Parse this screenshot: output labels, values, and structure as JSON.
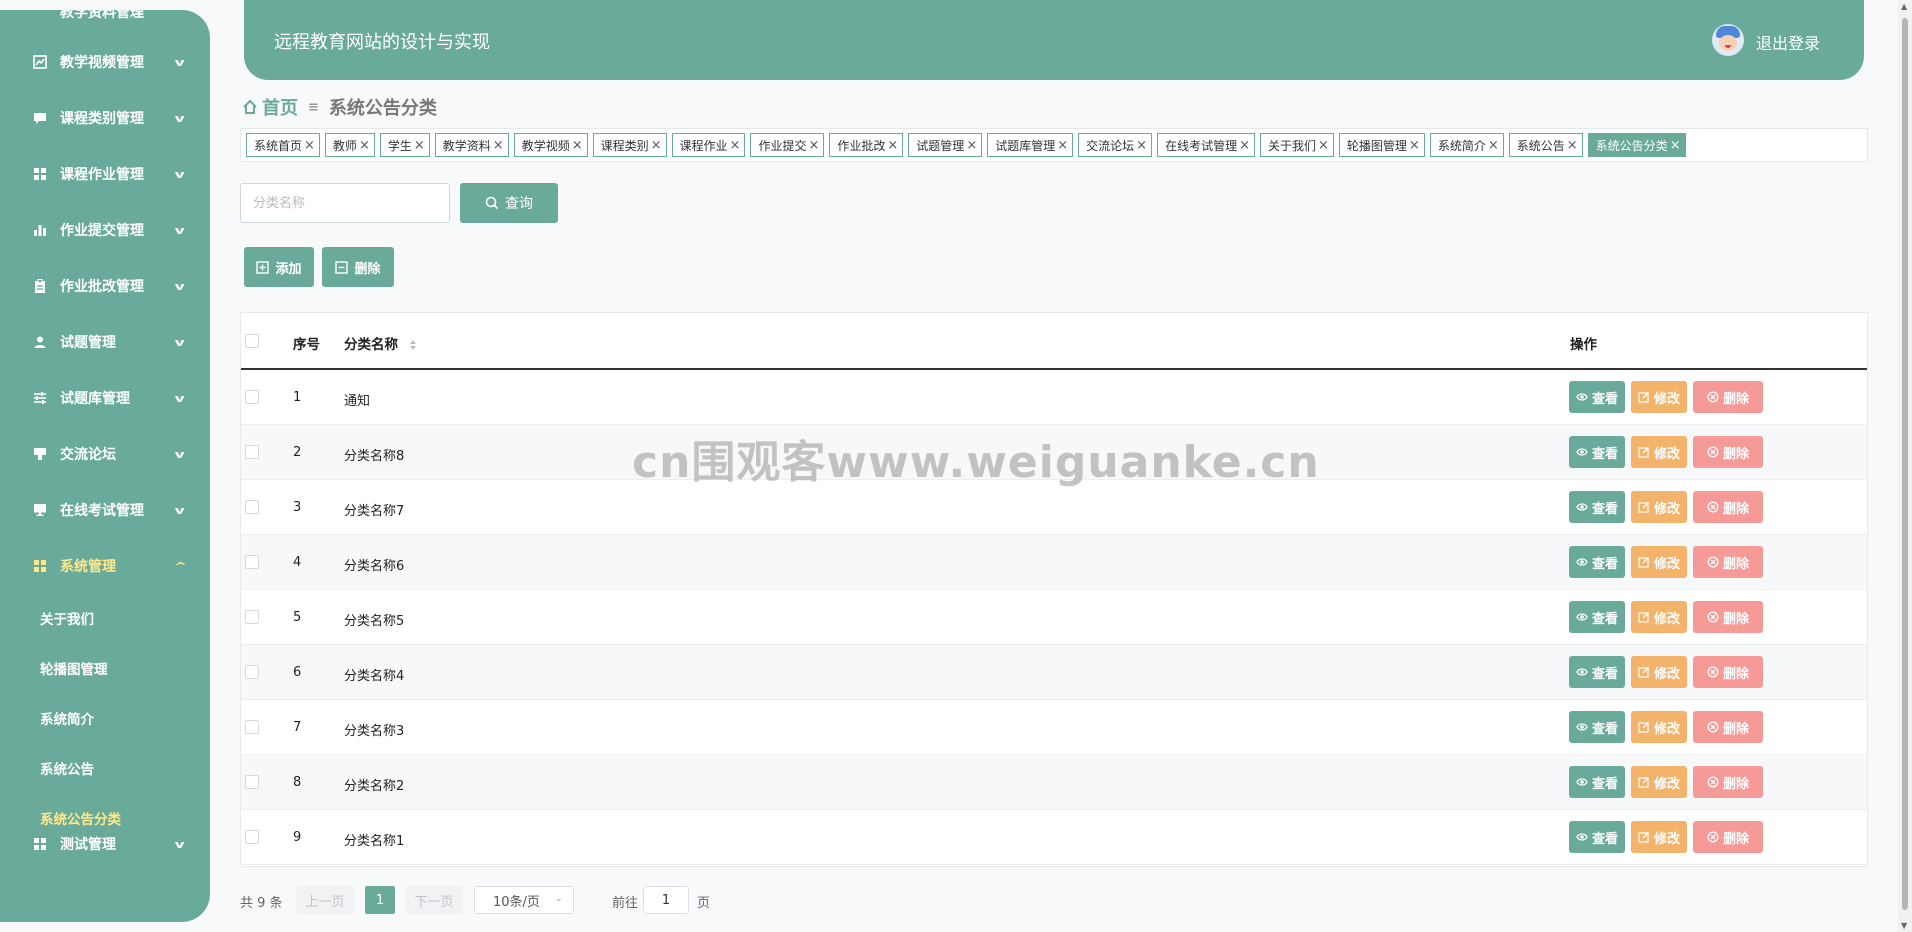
{
  "header": {
    "title": "远程教育网站的设计与实现",
    "logout": "退出登录"
  },
  "sidebar": {
    "top_partial": "教学资料管理",
    "items": [
      {
        "label": "教学视频管理",
        "icon": "chart-icon",
        "expanded": false
      },
      {
        "label": "课程类别管理",
        "icon": "chat-icon",
        "expanded": false
      },
      {
        "label": "课程作业管理",
        "icon": "grid-icon",
        "expanded": false
      },
      {
        "label": "作业提交管理",
        "icon": "bar-chart-icon",
        "expanded": false
      },
      {
        "label": "作业批改管理",
        "icon": "clipboard-icon",
        "expanded": false
      },
      {
        "label": "试题管理",
        "icon": "user-icon",
        "expanded": false
      },
      {
        "label": "试题库管理",
        "icon": "sliders-icon",
        "expanded": false
      },
      {
        "label": "交流论坛",
        "icon": "comment-icon",
        "expanded": false
      },
      {
        "label": "在线考试管理",
        "icon": "monitor-icon",
        "expanded": false
      },
      {
        "label": "系统管理",
        "icon": "grid-icon",
        "expanded": true
      },
      {
        "label": "测试管理",
        "icon": "grid-icon",
        "expanded": false
      }
    ],
    "sub_items": [
      "关于我们",
      "轮播图管理",
      "系统简介",
      "系统公告",
      "系统公告分类"
    ]
  },
  "breadcrumb": {
    "home": "首页",
    "current": "系统公告分类"
  },
  "tags": [
    "系统首页",
    "教师",
    "学生",
    "教学资料",
    "教学视频",
    "课程类别",
    "课程作业",
    "作业提交",
    "作业批改",
    "试题管理",
    "试题库管理",
    "交流论坛",
    "在线考试管理",
    "关于我们",
    "轮播图管理",
    "系统简介",
    "系统公告",
    "系统公告分类"
  ],
  "search": {
    "placeholder": "分类名称",
    "query_label": "查询"
  },
  "toolbar": {
    "add_label": "添加",
    "delete_label": "删除"
  },
  "table": {
    "columns": {
      "index": "序号",
      "name": "分类名称",
      "ops": "操作"
    },
    "rows": [
      {
        "index": "1",
        "name": "通知"
      },
      {
        "index": "2",
        "name": "分类名称8"
      },
      {
        "index": "3",
        "name": "分类名称7"
      },
      {
        "index": "4",
        "name": "分类名称6"
      },
      {
        "index": "5",
        "name": "分类名称5"
      },
      {
        "index": "6",
        "name": "分类名称4"
      },
      {
        "index": "7",
        "name": "分类名称3"
      },
      {
        "index": "8",
        "name": "分类名称2"
      },
      {
        "index": "9",
        "name": "分类名称1"
      }
    ],
    "actions": {
      "view": "查看",
      "edit": "修改",
      "delete": "删除"
    }
  },
  "pagination": {
    "total": "共 9 条",
    "prev": "上一页",
    "current": "1",
    "next": "下一页",
    "page_size": "10条/页",
    "goto_prefix": "前往",
    "goto_value": "1",
    "goto_suffix": "页"
  },
  "watermark": "cn围观客www.weiguanke.cn",
  "colors": {
    "primary": "#6aaa9b",
    "edit": "#f4b36a",
    "delete": "#f69a98",
    "active_menu": "#ffe88a"
  }
}
